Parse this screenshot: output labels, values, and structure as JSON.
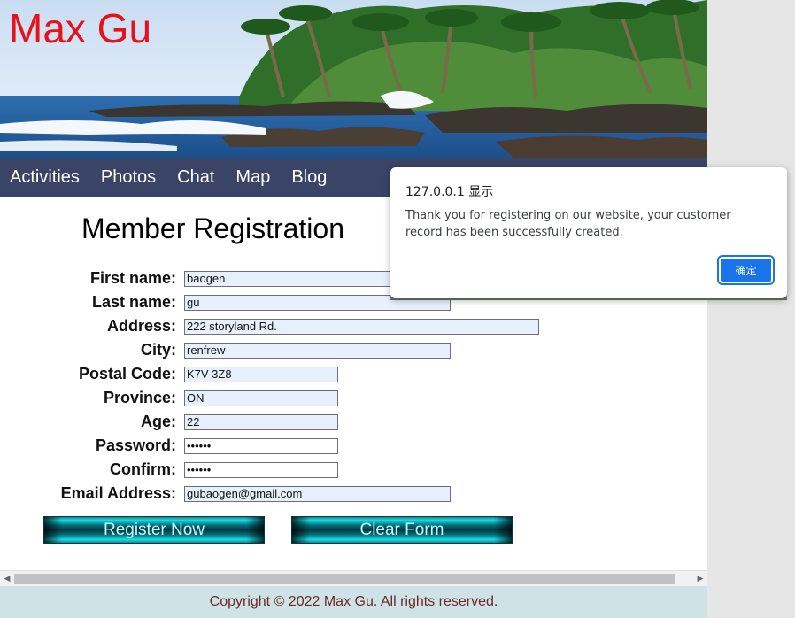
{
  "site": {
    "title": "Max Gu"
  },
  "nav": {
    "items": [
      "Activities",
      "Photos",
      "Chat",
      "Map",
      "Blog"
    ]
  },
  "registration": {
    "heading": "Member Registration",
    "fields": [
      {
        "label": "First name:",
        "value": "baogen"
      },
      {
        "label": "Last name:",
        "value": "gu"
      },
      {
        "label": "Address:",
        "value": "222 storyland Rd."
      },
      {
        "label": "City:",
        "value": "renfrew"
      },
      {
        "label": "Postal Code:",
        "value": "K7V 3Z8"
      },
      {
        "label": "Province:",
        "value": "ON"
      },
      {
        "label": "Age:",
        "value": "22"
      },
      {
        "label": "Password:",
        "value": "••••••"
      },
      {
        "label": "Confirm:",
        "value": "••••••"
      },
      {
        "label": "Email Address:",
        "value": "gubaogen@gmail.com"
      }
    ],
    "register_button": "Register Now",
    "clear_button": "Clear Form"
  },
  "footer": {
    "text": "Copyright © 2022 Max Gu. All rights reserved."
  },
  "dialog": {
    "title": "127.0.0.1 显示",
    "message": "Thank you for registering on our website, your customer record has been successfully created.",
    "ok_label": "确定"
  },
  "colors": {
    "nav_bg": "#3a4466",
    "title_red": "#e8101a",
    "footer_bg": "#cfe3e6",
    "dialog_button": "#1a73e8"
  },
  "icons": {
    "scroll_left": "triangle-left-icon",
    "scroll_right": "triangle-right-icon"
  }
}
